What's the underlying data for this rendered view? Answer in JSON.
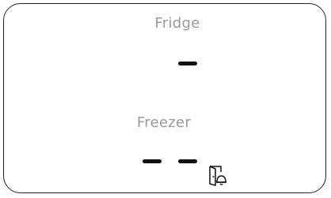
{
  "display": {
    "fridge": {
      "label": "Fridge",
      "temperature_readout": "—"
    },
    "freezer": {
      "label": "Freezer",
      "temperature_readout": "— —"
    },
    "indicators": {
      "door_alarm_icon": "door-alarm-icon"
    }
  }
}
